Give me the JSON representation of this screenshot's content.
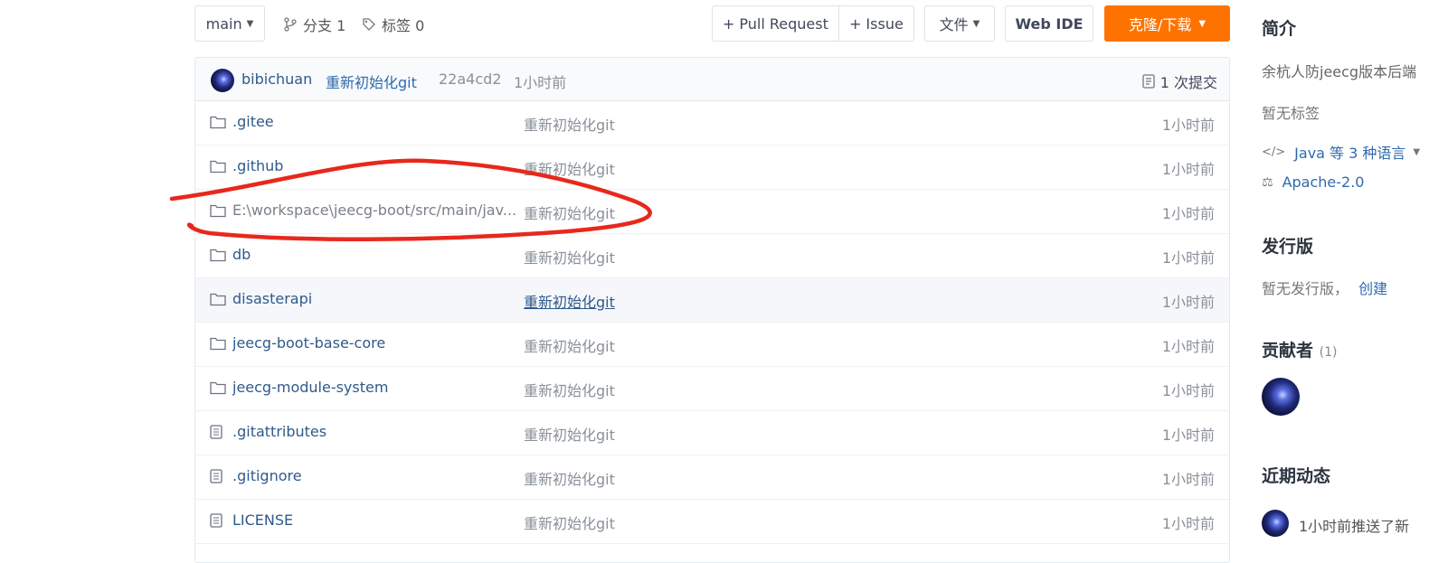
{
  "toolbar": {
    "branch": "main",
    "branches": "分支 1",
    "tags": "标签 0",
    "pull_request": "+ Pull Request",
    "issue": "+ Issue",
    "file": "文件",
    "web_ide": "Web IDE",
    "clone": "克隆/下载"
  },
  "commit": {
    "author": "bibichuan",
    "message": "重新初始化git",
    "hash": "22a4cd2",
    "time": "1小时前",
    "count": "1 次提交"
  },
  "files": [
    {
      "type": "folder",
      "name": ".gitee",
      "message": "重新初始化git",
      "time": "1小时前"
    },
    {
      "type": "folder",
      "name": ".github",
      "message": "重新初始化git",
      "time": "1小时前"
    },
    {
      "type": "folder",
      "name": "E:\\workspace\\jeecg-boot/src/main/jav...",
      "message": "重新初始化git",
      "time": "1小时前"
    },
    {
      "type": "folder",
      "name": "db",
      "message": "重新初始化git",
      "time": "1小时前"
    },
    {
      "type": "folder",
      "name": "disasterapi",
      "message": "重新初始化git",
      "time": "1小时前"
    },
    {
      "type": "folder",
      "name": "jeecg-boot-base-core",
      "message": "重新初始化git",
      "time": "1小时前"
    },
    {
      "type": "folder",
      "name": "jeecg-module-system",
      "message": "重新初始化git",
      "time": "1小时前"
    },
    {
      "type": "file",
      "name": ".gitattributes",
      "message": "重新初始化git",
      "time": "1小时前"
    },
    {
      "type": "file",
      "name": ".gitignore",
      "message": "重新初始化git",
      "time": "1小时前"
    },
    {
      "type": "file",
      "name": "LICENSE",
      "message": "重新初始化git",
      "time": "1小时前"
    }
  ],
  "sidebar": {
    "intro_title": "简介",
    "intro_text": "余杭人防jeecg版本后端",
    "no_tags": "暂无标签",
    "language": "Java 等 3 种语言",
    "license": "Apache-2.0",
    "release_title": "发行版",
    "no_release": "暂无发行版，",
    "create": "创建",
    "contributors_title": "贡献者",
    "contributors_count": "(1)",
    "activity_title": "近期动态",
    "activity_text": "1小时前推送了新"
  },
  "annotation_color": "#e8281c",
  "accent_color": "#fe7300"
}
